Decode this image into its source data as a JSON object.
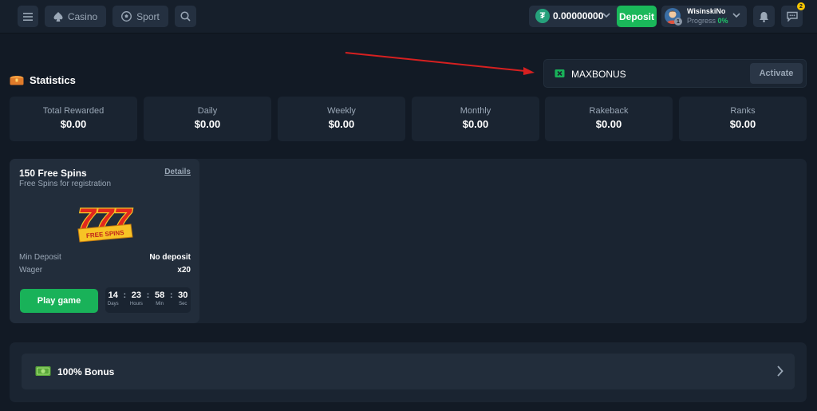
{
  "header": {
    "casino_label": "Casino",
    "sport_label": "Sport",
    "balance": "0.00000000",
    "deposit_label": "Deposit",
    "username": "WisinskiNo",
    "progress_label": "Progress",
    "progress_value": "0%",
    "level": "1",
    "chat_badge": "2"
  },
  "promo": {
    "code": "MAXBONUS",
    "activate_label": "Activate"
  },
  "statistics": {
    "title": "Statistics",
    "cards": [
      {
        "label": "Total Rewarded",
        "value": "$0.00"
      },
      {
        "label": "Daily",
        "value": "$0.00"
      },
      {
        "label": "Weekly",
        "value": "$0.00"
      },
      {
        "label": "Monthly",
        "value": "$0.00"
      },
      {
        "label": "Rakeback",
        "value": "$0.00"
      },
      {
        "label": "Ranks",
        "value": "$0.00"
      }
    ]
  },
  "bonus_card": {
    "title": "150 Free Spins",
    "subtitle": "Free Spins for registration",
    "details_label": "Details",
    "art_text": "777",
    "art_ribbon": "FREE SPINS",
    "min_deposit_label": "Min Deposit",
    "min_deposit_value": "No deposit",
    "wager_label": "Wager",
    "wager_value": "x20",
    "play_label": "Play game",
    "timer": {
      "days": "14",
      "hours": "23",
      "min": "58",
      "sec": "30",
      "days_label": "Days",
      "hours_label": "Hours",
      "min_label": "Min",
      "sec_label": "Sec"
    }
  },
  "bonus_row": {
    "label": "100% Bonus"
  },
  "colors": {
    "accent_green": "#1ab85a",
    "annotation_red": "#d62020",
    "badge_yellow": "#f6c500"
  }
}
